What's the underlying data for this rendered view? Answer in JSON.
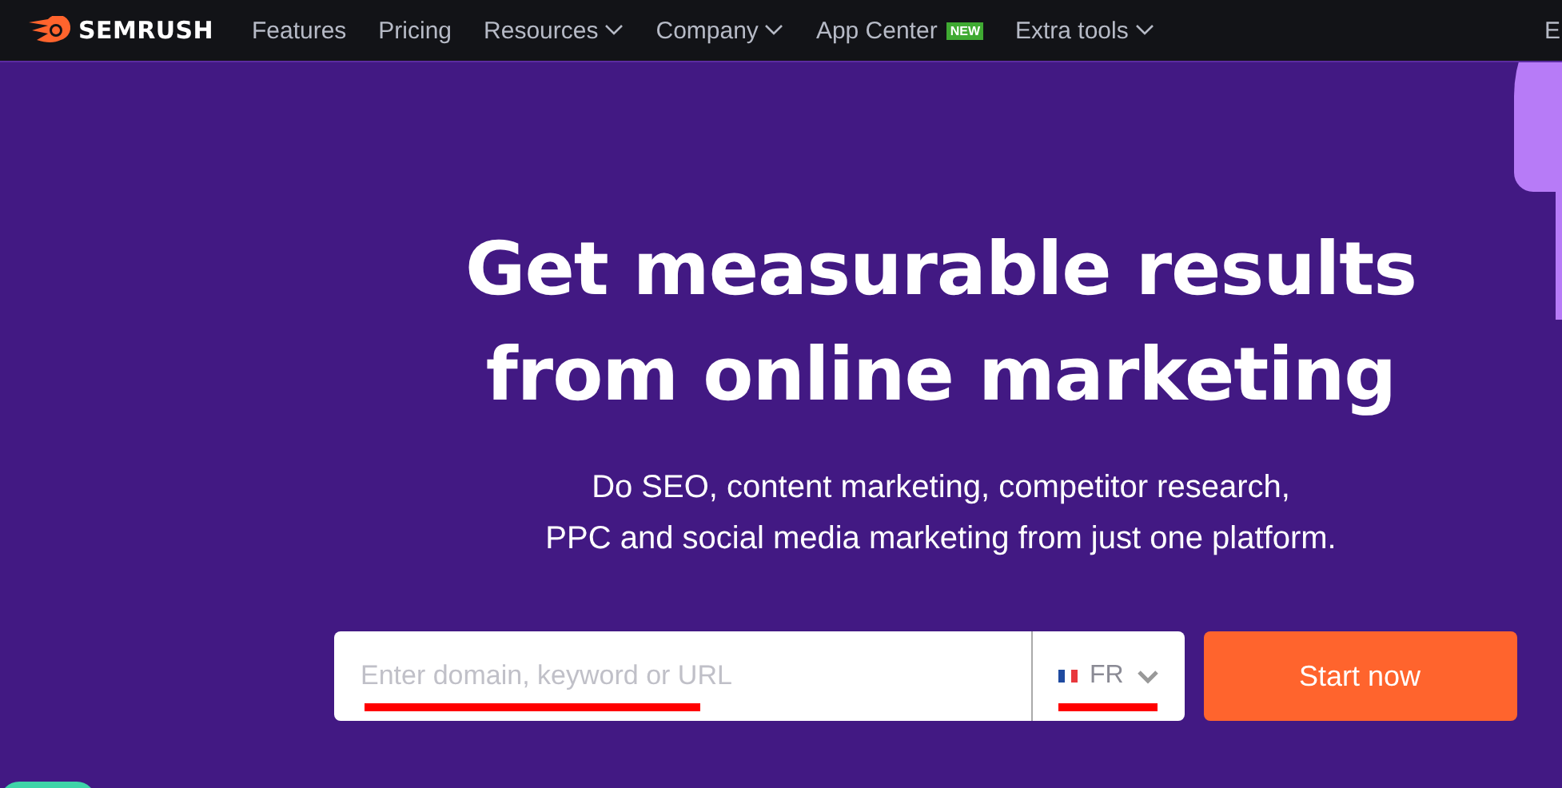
{
  "nav": {
    "logo": "SEMRUSH",
    "items": [
      {
        "label": "Features",
        "dropdown": false
      },
      {
        "label": "Pricing",
        "dropdown": false
      },
      {
        "label": "Resources",
        "dropdown": true
      },
      {
        "label": "Company",
        "dropdown": true
      },
      {
        "label": "App Center",
        "dropdown": false,
        "badge": "NEW"
      },
      {
        "label": "Extra tools",
        "dropdown": true
      }
    ],
    "language": "E"
  },
  "hero": {
    "title": "Get measurable results from online marketing",
    "subtitle_lines": [
      "Do SEO, content marketing, competitor research,",
      "PPC and social media marketing from just one platform."
    ],
    "search": {
      "placeholder": "Enter domain, keyword or URL",
      "country": "FR",
      "button": "Start now"
    }
  }
}
